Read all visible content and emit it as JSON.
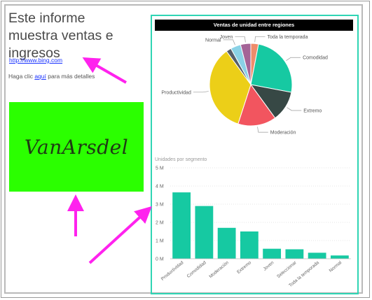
{
  "page": {
    "title": "Este informe muestra ventas e ingresos",
    "link_text": "http://www.bing.com",
    "detail_prefix": "Haga clic ",
    "detail_link": "aquí",
    "detail_suffix": " para más detalles",
    "logo_text": "VanArsdel",
    "logo_color": "#2bff00"
  },
  "pie_chart": {
    "title": "Ventas de unidad entre regiones",
    "colors": [
      "#ef8c6b",
      "#16c9a2",
      "#374845",
      "#f2555f",
      "#eccf18",
      "#555e6a",
      "#8ad2e6",
      "#a46497"
    ],
    "slices": [
      {
        "label": "Toda la temporada",
        "value": 3
      },
      {
        "label": "Comodidad",
        "value": 25
      },
      {
        "label": "Extremo",
        "value": 12
      },
      {
        "label": "Moderación",
        "value": 15
      },
      {
        "label": "Productividad",
        "value": 35
      },
      {
        "label": "",
        "value": 2
      },
      {
        "label": "Normal",
        "value": 4
      },
      {
        "label": "Joven",
        "value": 4
      }
    ]
  },
  "chart_data": {
    "type": "bar",
    "title": "Unidades por segmento",
    "categories": [
      "Productividad",
      "Comodidad",
      "Moderación",
      "Extremo",
      "Joven",
      "Seleccionar",
      "Toda la temporada",
      "Normal"
    ],
    "values": [
      3.65,
      2.9,
      1.7,
      1.5,
      0.55,
      0.52,
      0.33,
      0.18
    ],
    "ylim": [
      0,
      5
    ],
    "yticks": [
      "0 M",
      "1 M",
      "2 M",
      "3 M",
      "4 M",
      "5 M"
    ],
    "bar_color": "#16c9a2",
    "grid": true
  }
}
